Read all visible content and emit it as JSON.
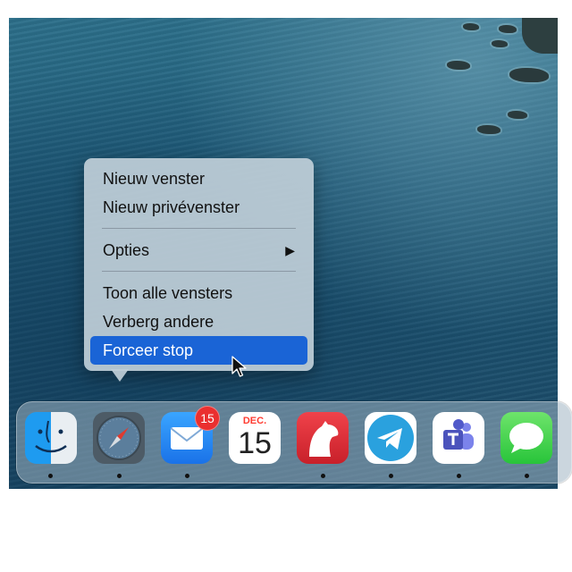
{
  "context_menu": {
    "items": [
      {
        "label": "Nieuw venster"
      },
      {
        "label": "Nieuw privévenster"
      },
      {
        "label": "Opties",
        "submenu_glyph": "▶"
      },
      {
        "label": "Toon alle vensters"
      },
      {
        "label": "Verberg andere"
      },
      {
        "label": "Forceer stop",
        "state": "highlighted"
      }
    ]
  },
  "dock": {
    "apps": [
      {
        "icon": "finder-icon",
        "running": true
      },
      {
        "icon": "safari-icon",
        "running": true
      },
      {
        "icon": "mail-icon",
        "badge": "15",
        "running": true
      },
      {
        "icon": "calendar-icon",
        "month": "DEC.",
        "day": "15",
        "running": false
      },
      {
        "icon": "bear-icon",
        "running": true
      },
      {
        "icon": "telegram-icon",
        "running": true
      },
      {
        "icon": "teams-icon",
        "running": true
      },
      {
        "icon": "messages-icon",
        "running": true
      }
    ]
  },
  "colors": {
    "highlight": "#1a64d6",
    "badge": "#ea2f2f",
    "calendar_month": "#ff3b30"
  }
}
